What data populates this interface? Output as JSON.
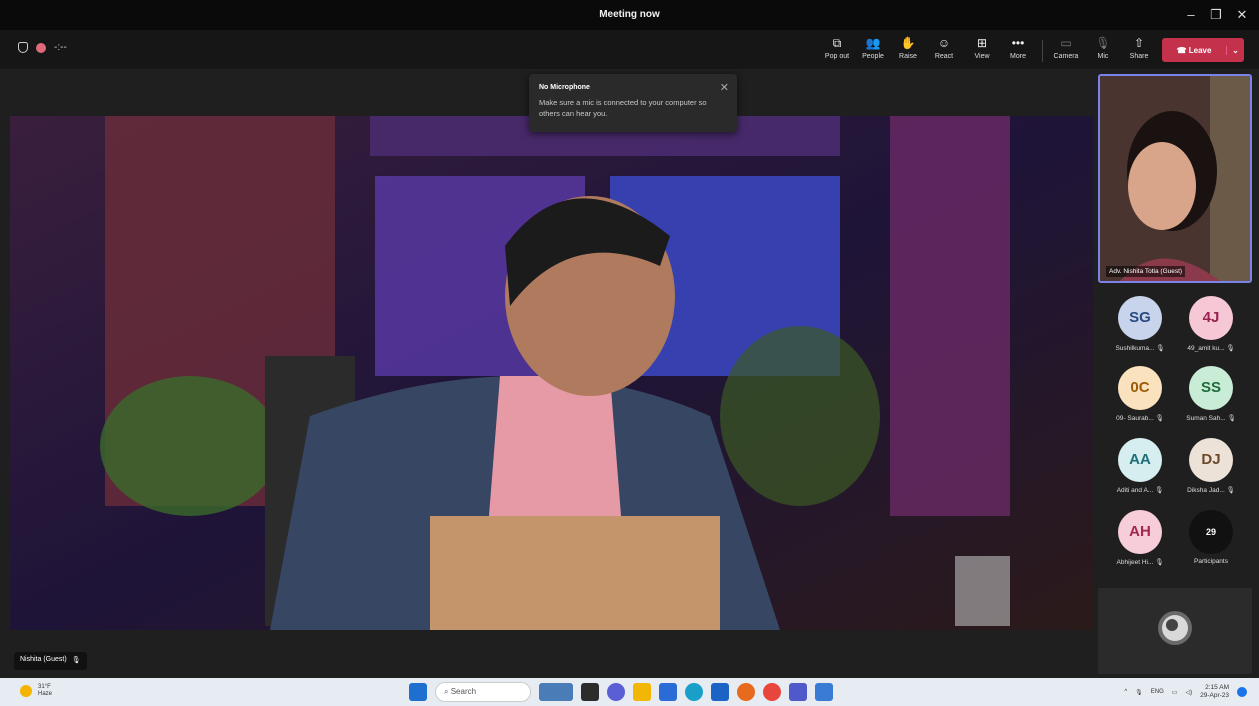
{
  "window": {
    "title": "Meeting now",
    "min": "–",
    "max": "❐",
    "close": "✕"
  },
  "toolbar": {
    "timer": "-:--",
    "buttons": [
      {
        "label": "Pop out",
        "icon": "⧉"
      },
      {
        "label": "People",
        "icon": "👥"
      },
      {
        "label": "Raise",
        "icon": "✋"
      },
      {
        "label": "React",
        "icon": "☺"
      },
      {
        "label": "View",
        "icon": "⊞"
      },
      {
        "label": "More",
        "icon": "•••"
      },
      {
        "label": "Camera",
        "icon": "▭"
      },
      {
        "label": "Mic",
        "icon": "🎙"
      },
      {
        "label": "Share",
        "icon": "⇧"
      }
    ],
    "leave_label": "Leave"
  },
  "notification": {
    "title": "No Microphone",
    "body": "Make sure a mic is connected to your computer so others can hear you."
  },
  "stage": {
    "speaker_name": "Nishita (Guest)"
  },
  "self_view": {
    "name": "Adv. Nishita Totla (Guest)"
  },
  "participants": [
    {
      "initials": "SG",
      "name": "Sushilkuma...",
      "bg": "#c7d4ec",
      "fg": "#2b4a80"
    },
    {
      "initials": "4J",
      "name": "49_amit ku...",
      "bg": "#f6c8d6",
      "fg": "#9b2050"
    },
    {
      "initials": "0C",
      "name": "09- Saurab...",
      "bg": "#f9e2bd",
      "fg": "#9a5b08"
    },
    {
      "initials": "SS",
      "name": "Suman Sah...",
      "bg": "#c9ecd6",
      "fg": "#1e6b3c"
    },
    {
      "initials": "AA",
      "name": "Aditi and A...",
      "bg": "#d6eef0",
      "fg": "#1e6f78"
    },
    {
      "initials": "DJ",
      "name": "Diksha Jad...",
      "bg": "#ede2d8",
      "fg": "#6b4a2a"
    },
    {
      "initials": "AH",
      "name": "Abhijeet Hi...",
      "bg": "#f6cdd8",
      "fg": "#a2284d"
    }
  ],
  "participants_count": {
    "count": "29",
    "label": "Participants"
  },
  "taskbar": {
    "weather_temp": "31°F",
    "weather_desc": "Haze",
    "search_placeholder": "Search",
    "language": "ENG",
    "time": "2:15 AM",
    "date": "29-Apr-23"
  }
}
